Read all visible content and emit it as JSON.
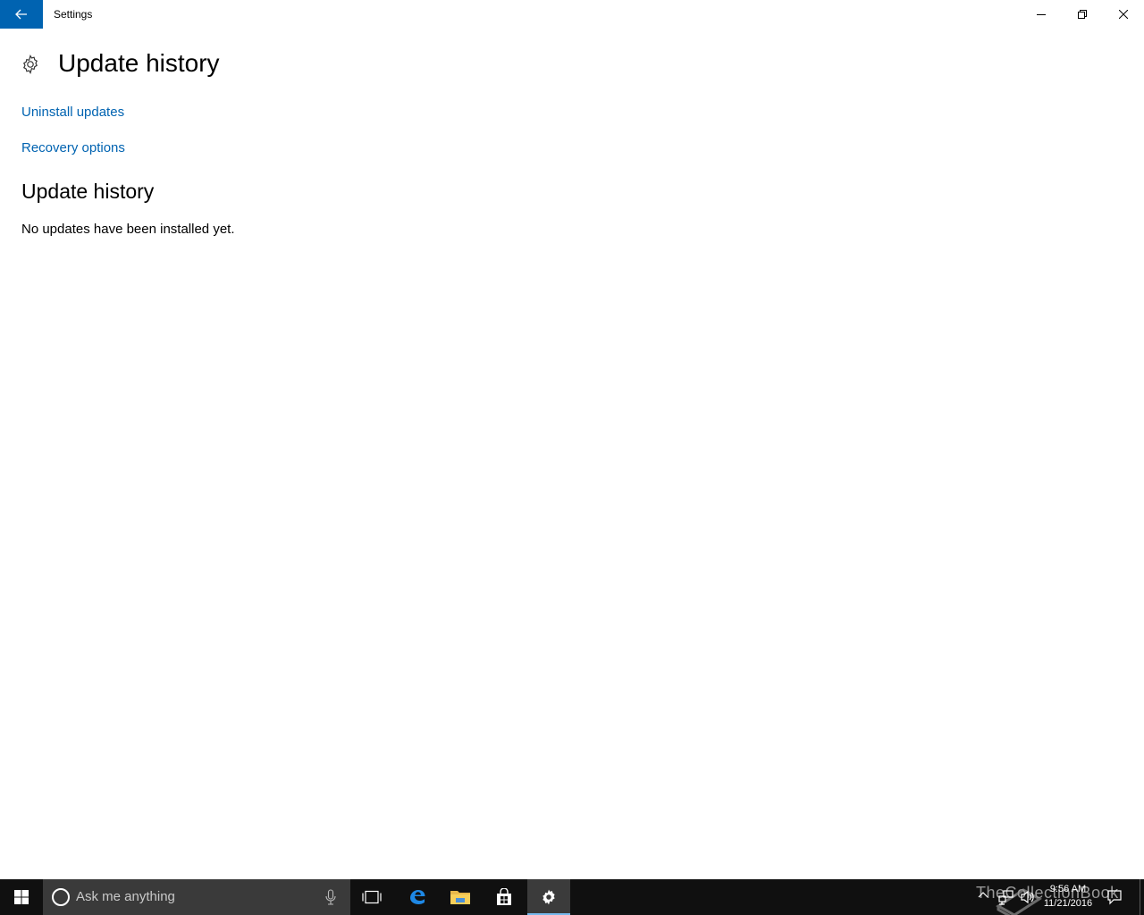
{
  "window": {
    "title": "Settings"
  },
  "page": {
    "title": "Update history",
    "links": {
      "uninstall": "Uninstall updates",
      "recovery": "Recovery options"
    },
    "section_title": "Update history",
    "empty_message": "No updates have been installed yet."
  },
  "taskbar": {
    "search_placeholder": "Ask me anything",
    "apps": [
      "task-view",
      "edge",
      "file-explorer",
      "store",
      "settings"
    ],
    "active_app": "settings",
    "clock": {
      "time": "9:56 AM",
      "date": "11/21/2016"
    }
  },
  "watermark": "TheCollectionBook",
  "colors": {
    "accent": "#0063b1",
    "taskbar_bg": "#101010",
    "search_bg": "#3a3a3a",
    "active_indicator": "#76b9ed"
  }
}
